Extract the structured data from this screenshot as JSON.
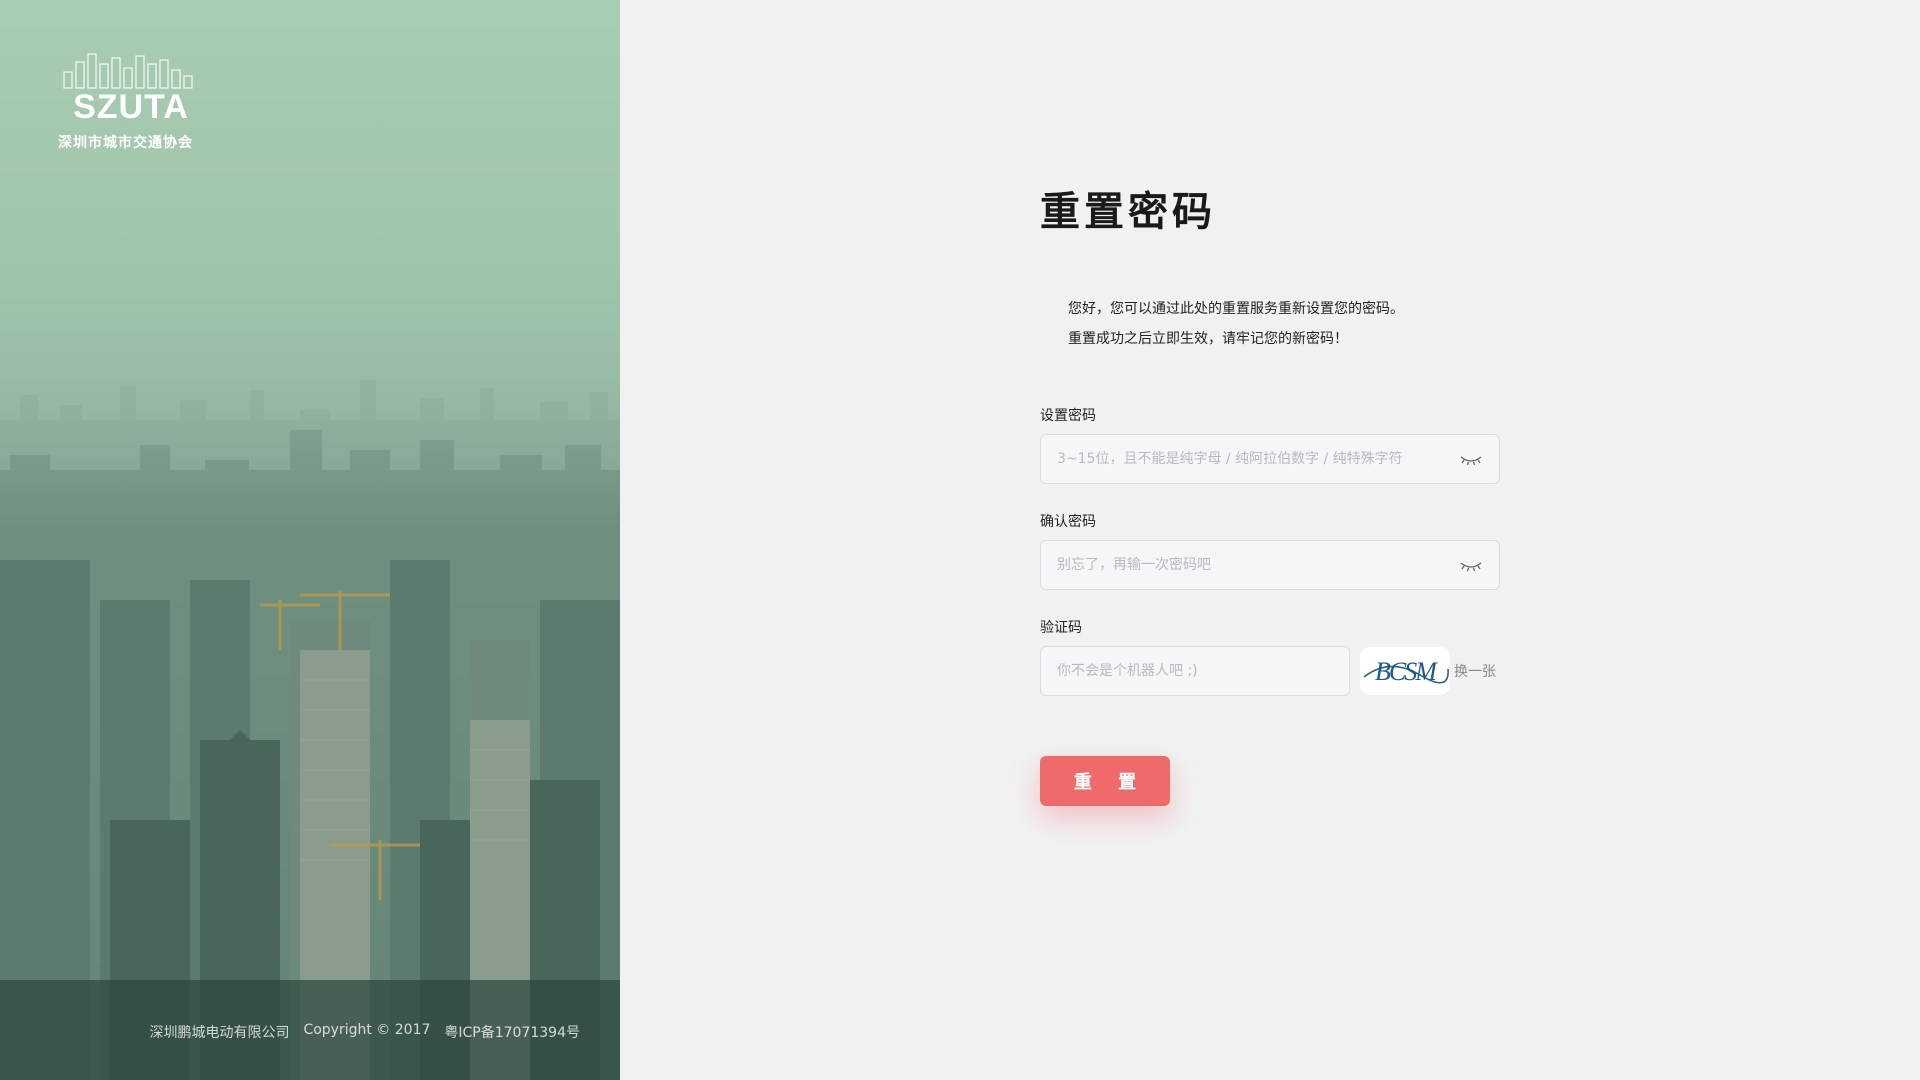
{
  "brand": {
    "logo_text": "SZUTA",
    "subtitle": "深圳市城市交通协会"
  },
  "footer": {
    "company": "深圳鹏城电动有限公司",
    "copyright": "Copyright © 2017",
    "icp": "粤ICP备17071394号"
  },
  "form": {
    "title": "重置密码",
    "intro_line_1": "您好，您可以通过此处的重置服务重新设置您的密码。",
    "intro_line_2": "重置成功之后立即生效，请牢记您的新密码！",
    "password": {
      "label": "设置密码",
      "value": "",
      "placeholder": "3~15位，且不能是纯字母 / 纯阿拉伯数字 / 纯特殊字符"
    },
    "confirm_password": {
      "label": "确认密码",
      "value": "",
      "placeholder": "别忘了，再输一次密码吧"
    },
    "captcha": {
      "label": "验证码",
      "value": "",
      "placeholder": "你不会是个机器人吧 ;)",
      "image_text": "BCSM",
      "refresh_label": "换一张"
    },
    "submit_label": "重 置"
  },
  "colors": {
    "accent": "#ef6b6b",
    "background": "#f1f1f3",
    "panel_top": "#a8ccb1",
    "panel_bottom": "#2f4a40"
  },
  "icons": {
    "toggle_password": "eye-closed-icon"
  }
}
